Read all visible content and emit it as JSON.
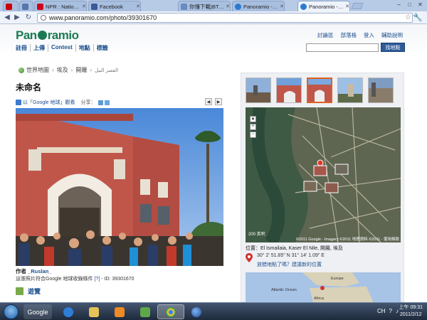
{
  "browser": {
    "tabs": [
      {
        "label": "NPR : National P",
        "favicon_color": "#d0021b"
      },
      {
        "label": "Facebook",
        "favicon_color": "#3b5998"
      },
      {
        "label": "你懂下載|BT|漫畫|",
        "favicon_color": "#6a8ac0"
      },
      {
        "label": "Panoramio - Pho",
        "favicon_color": "#2a7ad0"
      },
      {
        "label": "Panoramio - Unt",
        "favicon_color": "#2a7ad0"
      }
    ],
    "active_tab": 4,
    "url": "www.panoramio.com/photo/39301670",
    "window_controls": {
      "minimize": "–",
      "maximize": "□",
      "close": "✕"
    }
  },
  "site": {
    "logo_part1": "Pan",
    "logo_part2": "ramio",
    "main_nav": [
      "註冊",
      "上傳",
      "Contest",
      "地點",
      "標籤"
    ],
    "top_links": [
      "討論區",
      "部落格",
      "登入",
      "輔助說明"
    ],
    "search_placeholder": "",
    "search_button": "找地點"
  },
  "breadcrumb": {
    "items": [
      "世界地圖",
      "埃及",
      "開羅",
      "القصر النيل"
    ]
  },
  "photo": {
    "title": "未命名",
    "view_in_google_earth": "以「Google 地球」觀看",
    "share_label": "分享：",
    "author_prefix": "作者",
    "author_name": "_Ruslan_",
    "accepted_text": "這張照片符合Google 地球收錄條件",
    "help": "[?]",
    "id_text": "- ID: 39301670",
    "visits_label": "遊覽"
  },
  "sidebar": {
    "map_scale": "200 英呎",
    "map_attribution": "©2011 Google - Imagery ©2011 地理資料 ©2011 - 使用條款",
    "location": "位置：El Ismailaia, Kaser El Nile, 開羅, 埃及",
    "coords": "30° 2' 51.85\" N  31° 14' 1.09\" E",
    "wrong_location": "放錯地點了嗎？建議新的位置",
    "minimap_labels": [
      "Europe",
      "Atlantic Ocean",
      "Africa"
    ]
  },
  "taskbar": {
    "items": [
      "Google",
      "ie-icon",
      "folder-icon",
      "media-icon",
      "network-icon",
      "chrome-icon",
      "earth-icon"
    ],
    "tray": [
      "CH",
      "?"
    ],
    "time": "上午 09:31",
    "date": "2011/2/12"
  },
  "colors": {
    "brand_green": "#1c7a52",
    "link_blue": "#1b4f8f",
    "building_red": "#c0564a"
  }
}
